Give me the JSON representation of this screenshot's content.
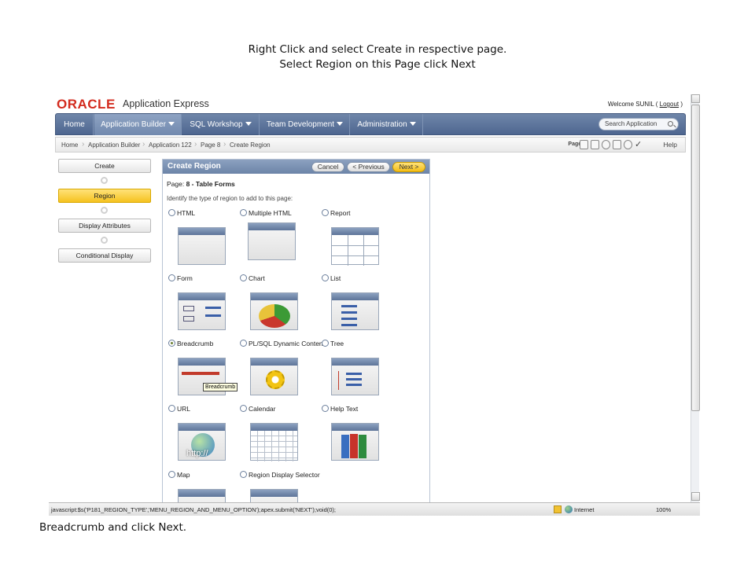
{
  "captions": {
    "top_line1": "Right Click and select Create in respective page.",
    "top_line2": "Select Region on this Page click Next",
    "bottom": "Breadcrumb and click Next."
  },
  "header": {
    "logo": "ORACLE",
    "product": "Application Express",
    "welcome": "Welcome SUNIL",
    "logout": "Logout"
  },
  "nav": {
    "tabs": [
      "Home",
      "Application Builder",
      "SQL Workshop",
      "Team Development",
      "Administration"
    ],
    "active_tab": "Application Builder",
    "search_placeholder": "Search Application"
  },
  "breadcrumb": {
    "items": [
      "Home",
      "Application Builder",
      "Application 122",
      "Page 8",
      "Create Region"
    ],
    "page_label": "Page 8",
    "help": "Help"
  },
  "wizard": {
    "steps": [
      "Create",
      "Region",
      "Display Attributes",
      "Conditional Display"
    ],
    "current_step": "Region"
  },
  "panel": {
    "title": "Create Region",
    "cancel": "Cancel",
    "previous": "< Previous",
    "next": "Next >",
    "page_label": "Page:",
    "page_value": "8 - Table Forms",
    "instruction": "Identify the type of region to add to this page:",
    "options": [
      {
        "label": "HTML",
        "selected": false
      },
      {
        "label": "Multiple HTML",
        "selected": false
      },
      {
        "label": "Report",
        "selected": false
      },
      {
        "label": "Form",
        "selected": false
      },
      {
        "label": "Chart",
        "selected": false
      },
      {
        "label": "List",
        "selected": false
      },
      {
        "label": "Breadcrumb",
        "selected": true
      },
      {
        "label": "PL/SQL Dynamic Content",
        "selected": false
      },
      {
        "label": "Tree",
        "selected": false
      },
      {
        "label": "URL",
        "selected": false
      },
      {
        "label": "Calendar",
        "selected": false
      },
      {
        "label": "Help Text",
        "selected": false
      },
      {
        "label": "Map",
        "selected": false
      },
      {
        "label": "Region Display Selector",
        "selected": false
      }
    ],
    "tooltip": "Breadcrumb",
    "url_thumb_text": "http://"
  },
  "statusbar": {
    "url": "javascript:$s('P181_REGION_TYPE','MENU_REGION_AND_MENU_OPTION');apex.submit('NEXT');void(0);",
    "zone": "Internet",
    "zoom": "100%"
  }
}
